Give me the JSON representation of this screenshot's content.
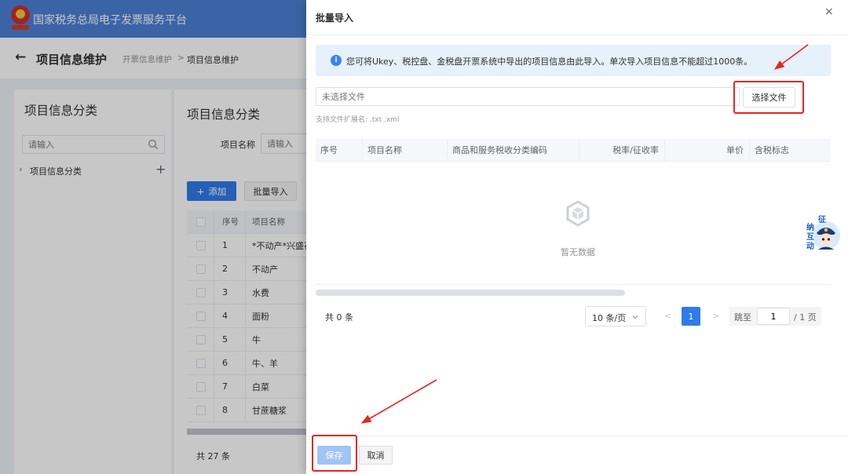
{
  "colors": {
    "header_bg": "#4c80d6",
    "primary": "#2f7bea",
    "primary_light": "#a0c4f5",
    "alert_bg": "#e6f1fc",
    "annotation": "#e8251f"
  },
  "header": {
    "logo_icon": "tax-emblem-logo",
    "title": "国家税务总局电子发票服务平台"
  },
  "breadcrumb": {
    "back_icon": "←",
    "page_title": "项目信息维护",
    "items": [
      "开票信息维护",
      "项目信息维护"
    ],
    "separator": ">"
  },
  "left_panel": {
    "title": "项目信息分类",
    "search_placeholder": "请输入",
    "search_icon": "search-icon",
    "tree": [
      {
        "caret": "›",
        "label": "项目信息分类",
        "add_icon": "+"
      }
    ]
  },
  "main_panel": {
    "title": "项目信息分类",
    "filter": {
      "label": "项目名称",
      "placeholder": "请输入"
    },
    "add_button": {
      "icon": "+",
      "label": "添加"
    },
    "import_button": "批量导入",
    "table": {
      "columns": [
        "序号",
        "项目名称"
      ],
      "rows": [
        {
          "no": "1",
          "name": "*不动产*兴盛花"
        },
        {
          "no": "2",
          "name": "不动产"
        },
        {
          "no": "3",
          "name": "水费"
        },
        {
          "no": "4",
          "name": "面粉"
        },
        {
          "no": "5",
          "name": "牛"
        },
        {
          "no": "6",
          "name": "牛、羊"
        },
        {
          "no": "7",
          "name": "白菜"
        },
        {
          "no": "8",
          "name": "甘蔗糖浆"
        }
      ]
    },
    "total": "共 27 条"
  },
  "drawer": {
    "title": "批量导入",
    "close_icon": "×",
    "alert": {
      "icon": "i",
      "text": "您可将Ukey、税控盘、金税盘开票系统中导出的项目信息由此导入。单次导入项目信息不能超过1000条。"
    },
    "file_input": {
      "placeholder": "未选择文件",
      "button": "选择文件",
      "hint": "支持文件扩展名: .txt .xml"
    },
    "table": {
      "columns": [
        "序号",
        "项目名称",
        "商品和服务税收分类编码",
        "税率/征收率",
        "单价",
        "含税标志"
      ],
      "empty_icon": "empty-box-icon",
      "empty_text": "暂无数据"
    },
    "pagination": {
      "total": "共 0 条",
      "page_size": "10 条/页",
      "prev": "<",
      "current": "1",
      "next": ">",
      "jump_label": "跳至",
      "jump_value": "1",
      "total_pages": "/ 1 页"
    },
    "footer": {
      "save": "保存",
      "cancel": "取消"
    }
  },
  "float_widget": {
    "icon": "service-avatar-icon",
    "chars": [
      "征",
      "纳",
      "互",
      "动"
    ]
  }
}
